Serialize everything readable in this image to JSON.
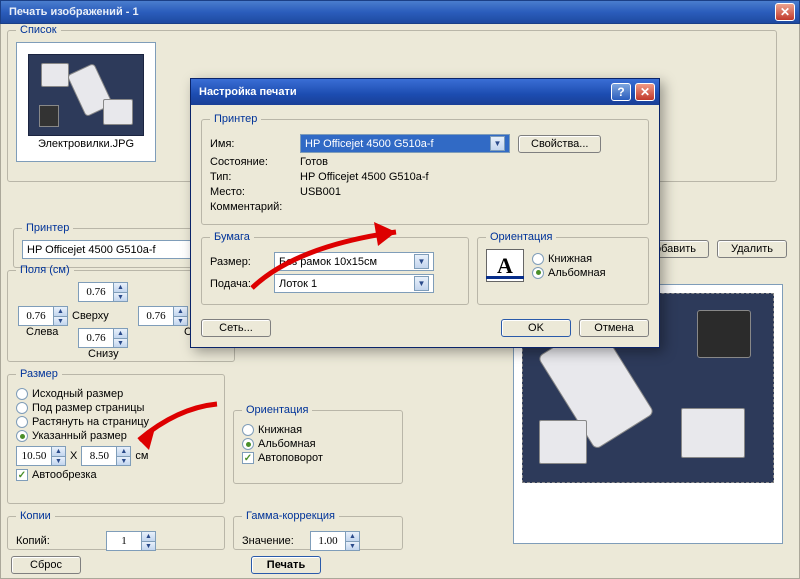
{
  "mainWindow": {
    "title": "Печать изображений - 1"
  },
  "list": {
    "legend": "Список",
    "thumbLabel": "Электровилки.JPG"
  },
  "printerGroup": {
    "legend": "Принтер",
    "value": "HP Officejet 4500 G510a-f",
    "addBtn": "Добавить",
    "removeBtn": "Удалить"
  },
  "margins": {
    "legend": "Поля (см)",
    "top": {
      "label": "Сверху",
      "value": "0.76"
    },
    "left": {
      "label": "Слева",
      "value": "0.76"
    },
    "right": {
      "label": "Справа",
      "value": "0.76"
    },
    "bottom": {
      "label": "Снизу",
      "value": "0.76"
    }
  },
  "size": {
    "legend": "Размер",
    "optOriginal": "Исходный размер",
    "optFitPage": "Под размер страницы",
    "optStretch": "Растянуть на страницу",
    "optCustom": "Указанный размер",
    "width": "10.50",
    "height": "8.50",
    "unit": "см",
    "x": "X",
    "autocrop": "Автообрезка"
  },
  "copies": {
    "legend": "Копии",
    "label": "Копий:",
    "value": "1"
  },
  "orientationPanel": {
    "legend": "Ориентация",
    "optPortrait": "Книжная",
    "optLandscape": "Альбомная",
    "autorotate": "Автоповорот"
  },
  "gamma": {
    "legend": "Гамма-коррекция",
    "label": "Значение:",
    "value": "1.00"
  },
  "bottomBtns": {
    "reset": "Сброс",
    "print": "Печать"
  },
  "dialog": {
    "title": "Настройка печати",
    "printerLegend": "Принтер",
    "nameLabel": "Имя:",
    "nameValue": "HP Officejet 4500 G510a-f",
    "propsBtn": "Свойства...",
    "stateLabel": "Состояние:",
    "stateValue": "Готов",
    "typeLabel": "Тип:",
    "typeValue": "HP Officejet 4500 G510a-f",
    "locLabel": "Место:",
    "locValue": "USB001",
    "commentLabel": "Комментарий:",
    "paperLegend": "Бумага",
    "sizeLabel": "Размер:",
    "sizeValue": "Без рамок 10x15см",
    "sourceLabel": "Подача:",
    "sourceValue": "Лоток 1",
    "orientLegend": "Ориентация",
    "orientPortrait": "Книжная",
    "orientLandscape": "Альбомная",
    "networkBtn": "Сеть...",
    "okBtn": "OK",
    "cancelBtn": "Отмена",
    "iconLetter": "A"
  }
}
